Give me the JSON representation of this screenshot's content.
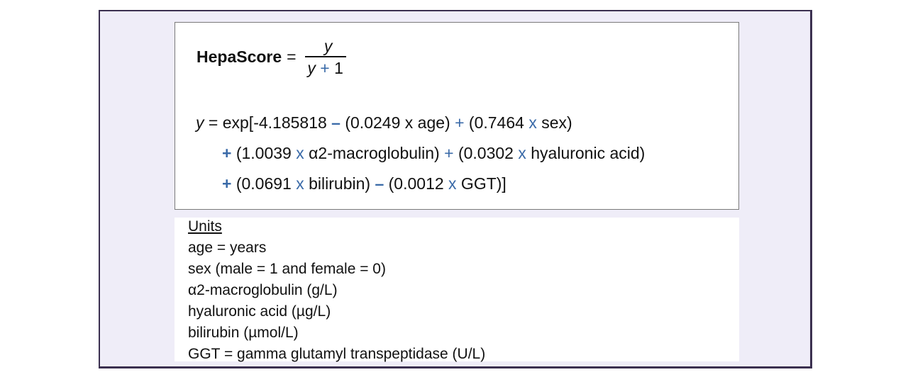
{
  "colors": {
    "frame_border": "#3b3050",
    "frame_fill": "#efedf8",
    "operator_accent": "#3a6aa8",
    "text": "#111111"
  },
  "formula": {
    "score_label": "HepaScore",
    "equals": "=",
    "numerator": "y",
    "denominator": {
      "var": "y",
      "op": "+",
      "const": "1"
    },
    "line1": {
      "var": "y",
      "equals": " = ",
      "prefix": "exp[-4.185818 ",
      "op1": "–",
      "term1": " (0.0249 x age) ",
      "op2": "+",
      "term2_open": " (0.7464 ",
      "x2": "x",
      "term2_close": " sex)"
    },
    "line2": {
      "op1": "+",
      "term1_open": " (1.0039 ",
      "x1": "x",
      "term1_close": " α2-macroglobulin) ",
      "op2": "+",
      "term2_open": " (0.0302 ",
      "x2": "x",
      "term2_close": " hyaluronic acid)"
    },
    "line3": {
      "op1": "+",
      "term1_open": " (0.0691 ",
      "x1": "x",
      "term1_close": " bilirubin) ",
      "op2": "–",
      "term2_open": " (0.0012 ",
      "x2": "x",
      "term2_close": " GGT)]"
    }
  },
  "units": {
    "title": "Units",
    "lines": [
      "age = years",
      "sex (male = 1 and female = 0)",
      "α2-macroglobulin (g/L)",
      "hyaluronic acid (µg/L)",
      "bilirubin (µmol/L)",
      "GGT = gamma glutamyl transpeptidase (U/L)"
    ]
  }
}
